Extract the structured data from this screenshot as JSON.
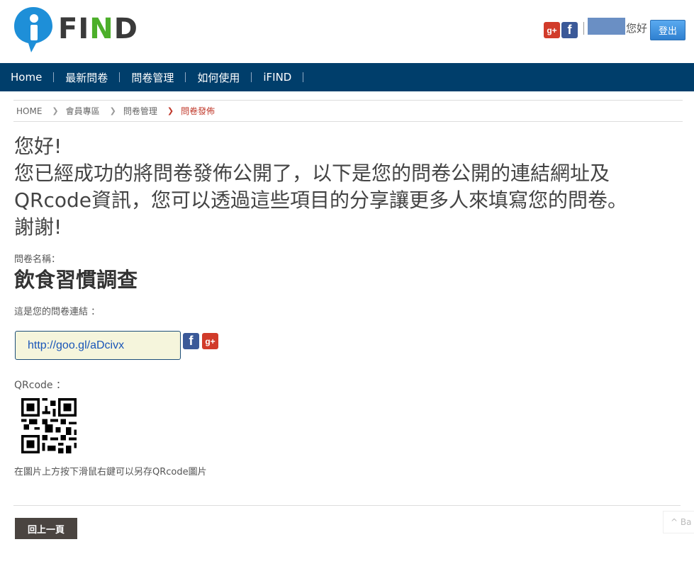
{
  "header": {
    "logo_text_pre": "FI",
    "logo_text_n": "N",
    "logo_text_post": "D",
    "social": {
      "gplus": "g+",
      "facebook": "f"
    },
    "hello": "您好",
    "logout_label": "登出"
  },
  "nav": {
    "items": [
      "Home",
      "最新問卷",
      "問卷管理",
      "如何使用",
      "iFIND"
    ]
  },
  "breadcrumb": {
    "items": [
      "HOME",
      "會員專區",
      "問卷管理",
      "問卷發佈"
    ]
  },
  "message": {
    "line1": "您好!",
    "line2": "您已經成功的將問卷發佈公開了，以下是您的問卷公開的連結網址及",
    "line3": "QRcode資訊，您可以透過這些項目的分享讓更多人來填寫您的問卷。",
    "line4": "謝謝!"
  },
  "survey": {
    "name_label": "問卷名稱：",
    "name": "飲食習慣調查",
    "link_label": "這是您的問卷連結 ：",
    "link_url": "http://goo.gl/aDcivx"
  },
  "qrcode": {
    "label": "QRcode ：",
    "hint": "在圖片上方按下滑鼠右鍵可以另存QRcode圖片"
  },
  "footer": {
    "back_label": "回上一頁",
    "back_to_top": "^ Ba"
  },
  "colors": {
    "nav_bg": "#003e6b",
    "accent_red": "#c0392b",
    "link_blue": "#1a56b8",
    "logo_blue": "#1e8fd8",
    "logo_green": "#4caf2a"
  }
}
